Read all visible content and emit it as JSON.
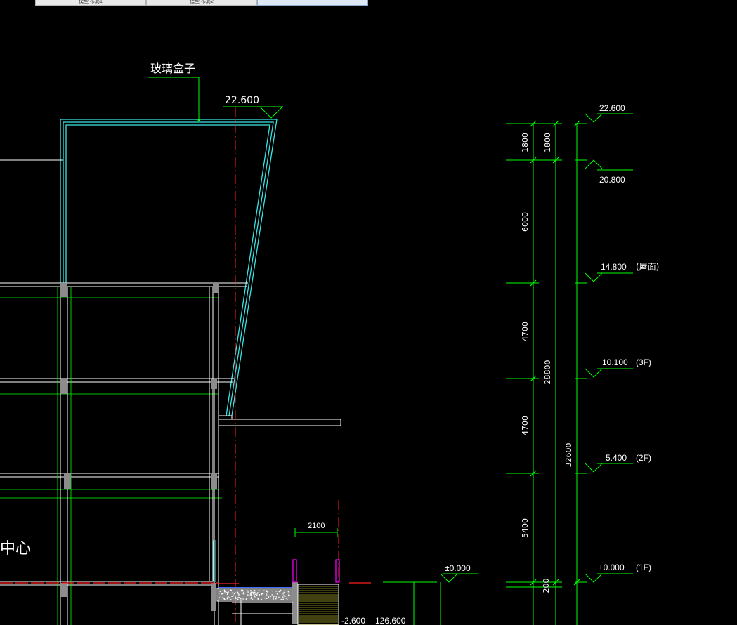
{
  "tabs": [
    {
      "label": "模型 布局1"
    },
    {
      "label": "模型 布局2"
    },
    {
      "label": ""
    }
  ],
  "labels": {
    "glass_box": "玻璃盒子",
    "top_elev_left": "22.600",
    "room_fragment": "中心",
    "width_2100": "2100",
    "zero_left": "±0.000",
    "neg_elev": "-2.600",
    "elev_126": "126.600"
  },
  "levels": [
    {
      "elev": "22.600",
      "note": ""
    },
    {
      "elev": "20.800",
      "note": ""
    },
    {
      "elev": "14.800",
      "note": "(屋面)"
    },
    {
      "elev": "10.100",
      "note": "(3F)"
    },
    {
      "elev": "5.400",
      "note": "(2F)"
    },
    {
      "elev": "±0.000",
      "note": "(1F)"
    }
  ],
  "dims": {
    "seg1": "1800",
    "seg1b": "1800",
    "seg2": "6000",
    "seg3": "4700",
    "seg4": "4700",
    "seg5": "5400",
    "seg6": "200",
    "total_28800": "28800",
    "total_32600": "32600"
  },
  "colors": {
    "background": "#000000",
    "dim_green": "#00ff00",
    "wall_white": "#ffffff",
    "glass_cyan": "#39e6e6",
    "axis_red": "#ff2020",
    "column_gray": "#8c8c8c",
    "magenta": "#ff00ff",
    "yellow": "#ffff40"
  }
}
